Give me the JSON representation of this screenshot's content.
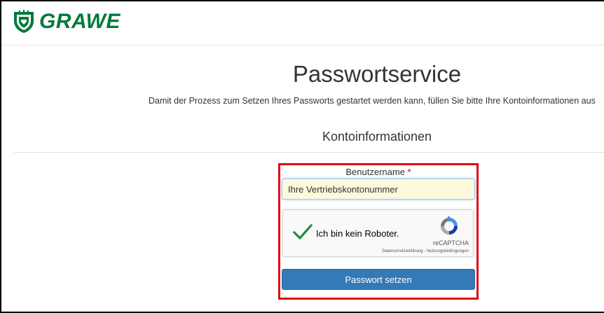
{
  "header": {
    "logo_text": "GRAWE",
    "logo_icon": "grawe-shield-icon",
    "brand_color": "#007a3d"
  },
  "page": {
    "title": "Passwortservice",
    "intro": "Damit der Prozess zum Setzen Ihres Passworts gestartet werden kann, füllen Sie bitte Ihre Kontoinformationen aus"
  },
  "section": {
    "title": "Kontoinformationen"
  },
  "form": {
    "username_label": "Benutzername",
    "required_marker": "*",
    "username_value": "Ihre Vertriebskontonummer",
    "highlight_color": "#e30613"
  },
  "recaptcha": {
    "label": "Ich bin kein Roboter.",
    "checked": true,
    "check_color": "#1e8e3e",
    "brand": "reCAPTCHA",
    "privacy_link": "Datenschutzerklärung",
    "separator": " - ",
    "terms_link": "Nutzungsbedingungen",
    "logo_icon": "recaptcha-logo-icon"
  },
  "submit": {
    "label": "Passwort setzen",
    "color": "#337ab7"
  }
}
